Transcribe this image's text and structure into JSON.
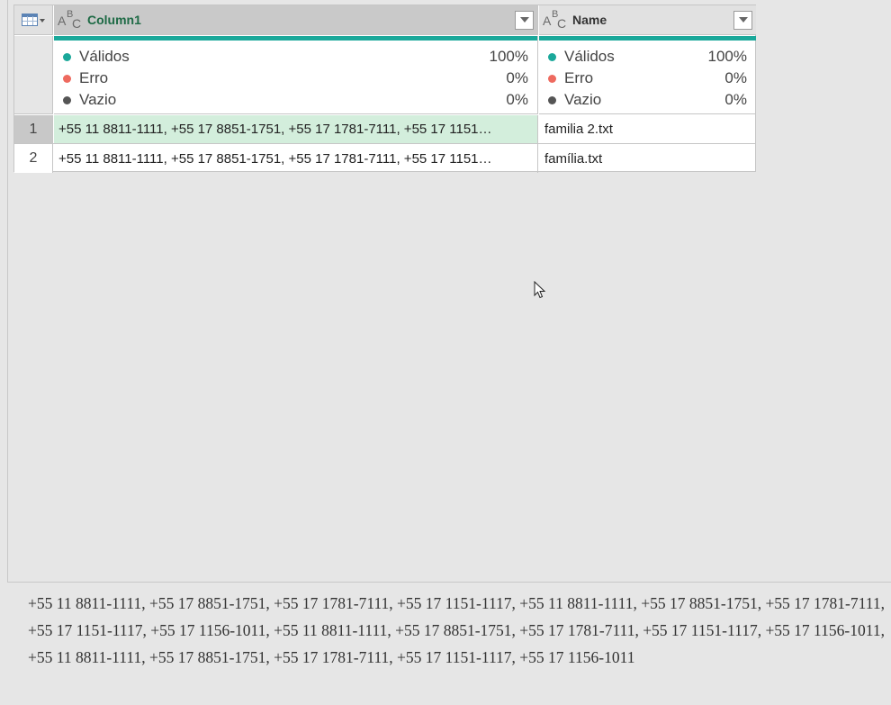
{
  "grid": {
    "columns": [
      {
        "name": "Column1",
        "type_icon": "abc-text-type-icon",
        "quality": [
          {
            "label": "Válidos",
            "pct": "100%"
          },
          {
            "label": "Erro",
            "pct": "0%"
          },
          {
            "label": "Vazio",
            "pct": "0%"
          }
        ]
      },
      {
        "name": "Name",
        "type_icon": "abc-text-type-icon",
        "quality": [
          {
            "label": "Válidos",
            "pct": "100%"
          },
          {
            "label": "Erro",
            "pct": "0%"
          },
          {
            "label": "Vazio",
            "pct": "0%"
          }
        ]
      }
    ],
    "rows": [
      {
        "num": "1",
        "column1": "+55 11 8811-1111, +55 17 8851-1751, +55 17 1781-7111, +55 17 1151…",
        "name": "familia 2.txt"
      },
      {
        "num": "2",
        "column1": "+55 11 8811-1111, +55 17 8851-1751, +55 17 1781-7111, +55 17 1151…",
        "name": "família.txt"
      }
    ]
  },
  "colors": {
    "valid": "#1aa89a",
    "error": "#ee6a5f",
    "empty": "#555555",
    "selected_cell": "#d3eedc"
  },
  "detail_text": "+55 11 8811-1111, +55 17 8851-1751, +55 17 1781-7111, +55 17 1151-1117, +55 11 8811-1111, +55 17 8851-1751, +55 17 1781-7111, +55 17 1151-1117, +55 17 1156-1011, +55 11 8811-1111, +55 17 8851-1751, +55 17 1781-7111, +55 17 1151-1117, +55 17 1156-1011, +55 11 8811-1111, +55 17 8851-1751, +55 17 1781-7111, +55 17 1151-1117, +55 17 1156-1011"
}
